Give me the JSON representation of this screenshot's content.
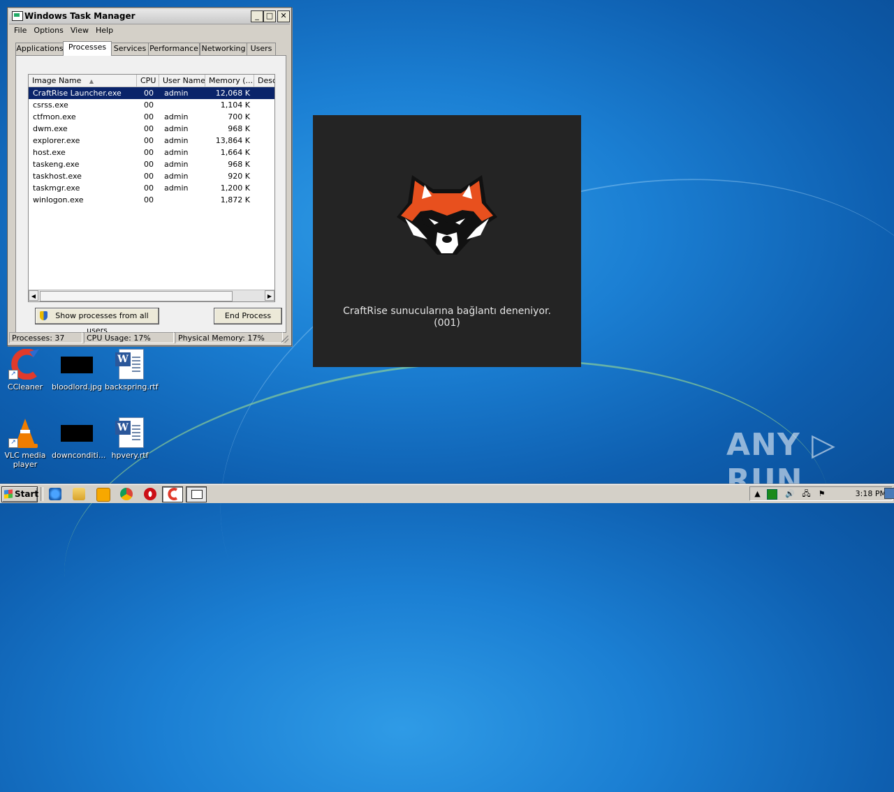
{
  "desktop": {
    "icons": [
      {
        "label": "CCleaner"
      },
      {
        "label": "bloodlord.jpg"
      },
      {
        "label": "backspring.rtf"
      },
      {
        "label": "VLC media player"
      },
      {
        "label": "downconditi..."
      },
      {
        "label": "hpvery.rtf"
      }
    ],
    "watermark": "ANY ▷ RUN"
  },
  "task_manager": {
    "title": "Windows Task Manager",
    "menu": [
      "File",
      "Options",
      "View",
      "Help"
    ],
    "tabs": [
      "Applications",
      "Processes",
      "Services",
      "Performance",
      "Networking",
      "Users"
    ],
    "active_tab": "Processes",
    "columns": [
      "Image Name",
      "CPU",
      "User Name",
      "Memory (...",
      "Desc"
    ],
    "sort_indicator": "▲",
    "rows": [
      {
        "name": "CraftRise Launcher.exe",
        "cpu": "00",
        "user": "admin",
        "memory": "12,068 K"
      },
      {
        "name": "csrss.exe",
        "cpu": "00",
        "user": "",
        "memory": "1,104 K"
      },
      {
        "name": "ctfmon.exe",
        "cpu": "00",
        "user": "admin",
        "memory": "700 K"
      },
      {
        "name": "dwm.exe",
        "cpu": "00",
        "user": "admin",
        "memory": "968 K"
      },
      {
        "name": "explorer.exe",
        "cpu": "00",
        "user": "admin",
        "memory": "13,864 K"
      },
      {
        "name": "host.exe",
        "cpu": "00",
        "user": "admin",
        "memory": "1,664 K"
      },
      {
        "name": "taskeng.exe",
        "cpu": "00",
        "user": "admin",
        "memory": "968 K"
      },
      {
        "name": "taskhost.exe",
        "cpu": "00",
        "user": "admin",
        "memory": "920 K"
      },
      {
        "name": "taskmgr.exe",
        "cpu": "00",
        "user": "admin",
        "memory": "1,200 K"
      },
      {
        "name": "winlogon.exe",
        "cpu": "00",
        "user": "",
        "memory": "1,872 K"
      }
    ],
    "selected_row": 0,
    "show_all_label": "Show processes from all users",
    "end_process_label": "End Process",
    "status": {
      "processes": "Processes: 37",
      "cpu": "CPU Usage: 17%",
      "memory": "Physical Memory: 17%"
    }
  },
  "splash": {
    "line1": "CraftRise sunucularına bağlantı deneniyor.",
    "line2": "(001)"
  },
  "taskbar": {
    "start_label": "Start",
    "clock": "3:18 PM"
  },
  "colors": {
    "selection": "#0a246a",
    "splash_bg": "#242424",
    "raccoon_orange": "#e8501e"
  }
}
